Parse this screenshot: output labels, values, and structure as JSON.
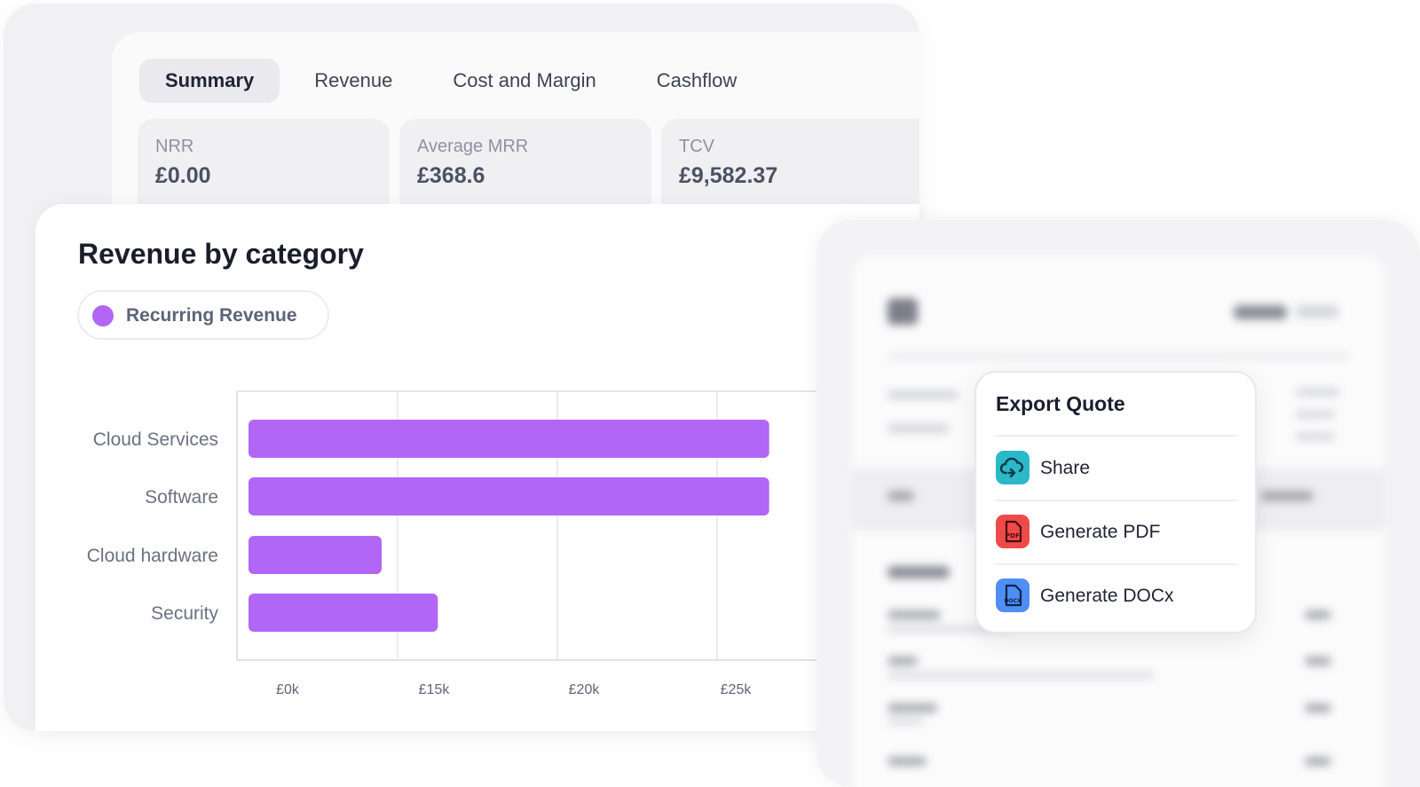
{
  "tabs": [
    {
      "label": "Summary",
      "active": true
    },
    {
      "label": "Revenue",
      "active": false
    },
    {
      "label": "Cost and Margin",
      "active": false
    },
    {
      "label": "Cashflow",
      "active": false
    }
  ],
  "kpis": [
    {
      "label": "NRR",
      "value": "£0.00"
    },
    {
      "label": "Average MRR",
      "value": "£368.6"
    },
    {
      "label": "TCV",
      "value": "£9,582.37"
    }
  ],
  "chart_data": {
    "type": "bar",
    "orientation": "horizontal",
    "title": "Revenue by category",
    "categories": [
      "Cloud Services",
      "Software",
      "Cloud hardware",
      "Security"
    ],
    "series": [
      {
        "name": "Recurring Revenue",
        "values": [
          27600,
          27600,
          14500,
          16400
        ],
        "color": "#b266f6"
      }
    ],
    "x_ticks": [
      "£0k",
      "£15k",
      "£20k",
      "£25k"
    ],
    "xlim": [
      10000,
      28000
    ],
    "grid": true,
    "legend_position": "top-left"
  },
  "export": {
    "title": "Export Quote",
    "items": [
      {
        "label": "Share",
        "icon": "cloud-share-icon",
        "color": "#2bb8c9"
      },
      {
        "label": "Generate PDF",
        "icon": "pdf-file-icon",
        "color": "#ef4a4a"
      },
      {
        "label": "Generate DOCx",
        "icon": "docx-file-icon",
        "color": "#4f8ef2"
      }
    ]
  }
}
